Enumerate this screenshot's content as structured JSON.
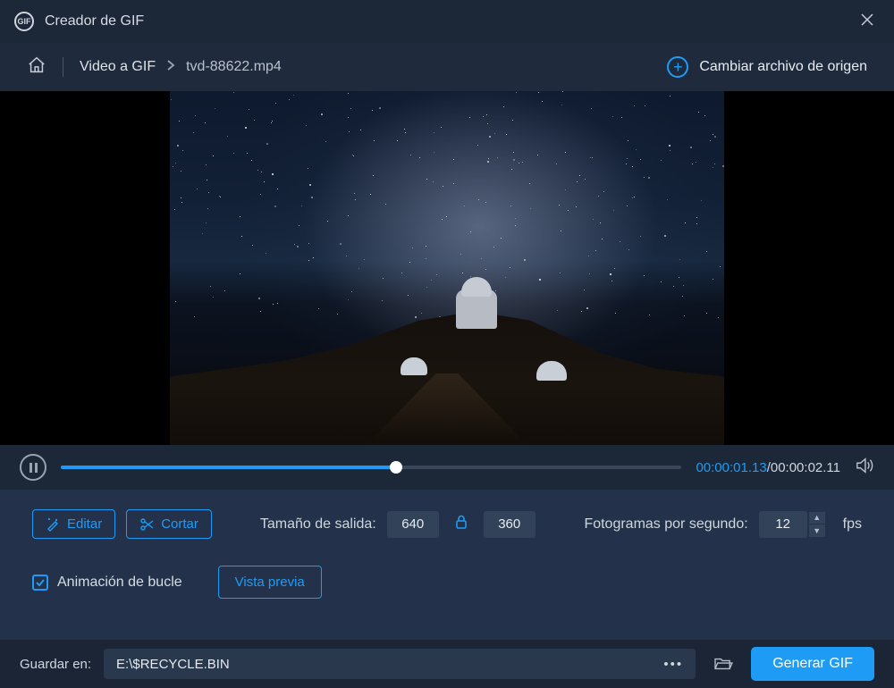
{
  "app": {
    "title": "Creador de GIF",
    "logo_text": "GIF"
  },
  "header": {
    "crumb1": "Video a GIF",
    "crumb2": "tvd-88622.mp4",
    "change_source": "Cambiar archivo de origen"
  },
  "playback": {
    "current": "00:00:01.13",
    "total": "00:00:02.11",
    "progress_pct": 54
  },
  "tools": {
    "edit": "Editar",
    "cut": "Cortar",
    "output_size_label": "Tamaño de salida:",
    "width": "640",
    "height": "360",
    "fps_label": "Fotogramas por segundo:",
    "fps_value": "12",
    "fps_unit": "fps",
    "loop_label": "Animación de bucle",
    "loop_checked": true,
    "preview": "Vista previa"
  },
  "footer": {
    "save_label": "Guardar en:",
    "path": "E:\\$RECYCLE.BIN",
    "generate": "Generar GIF"
  }
}
